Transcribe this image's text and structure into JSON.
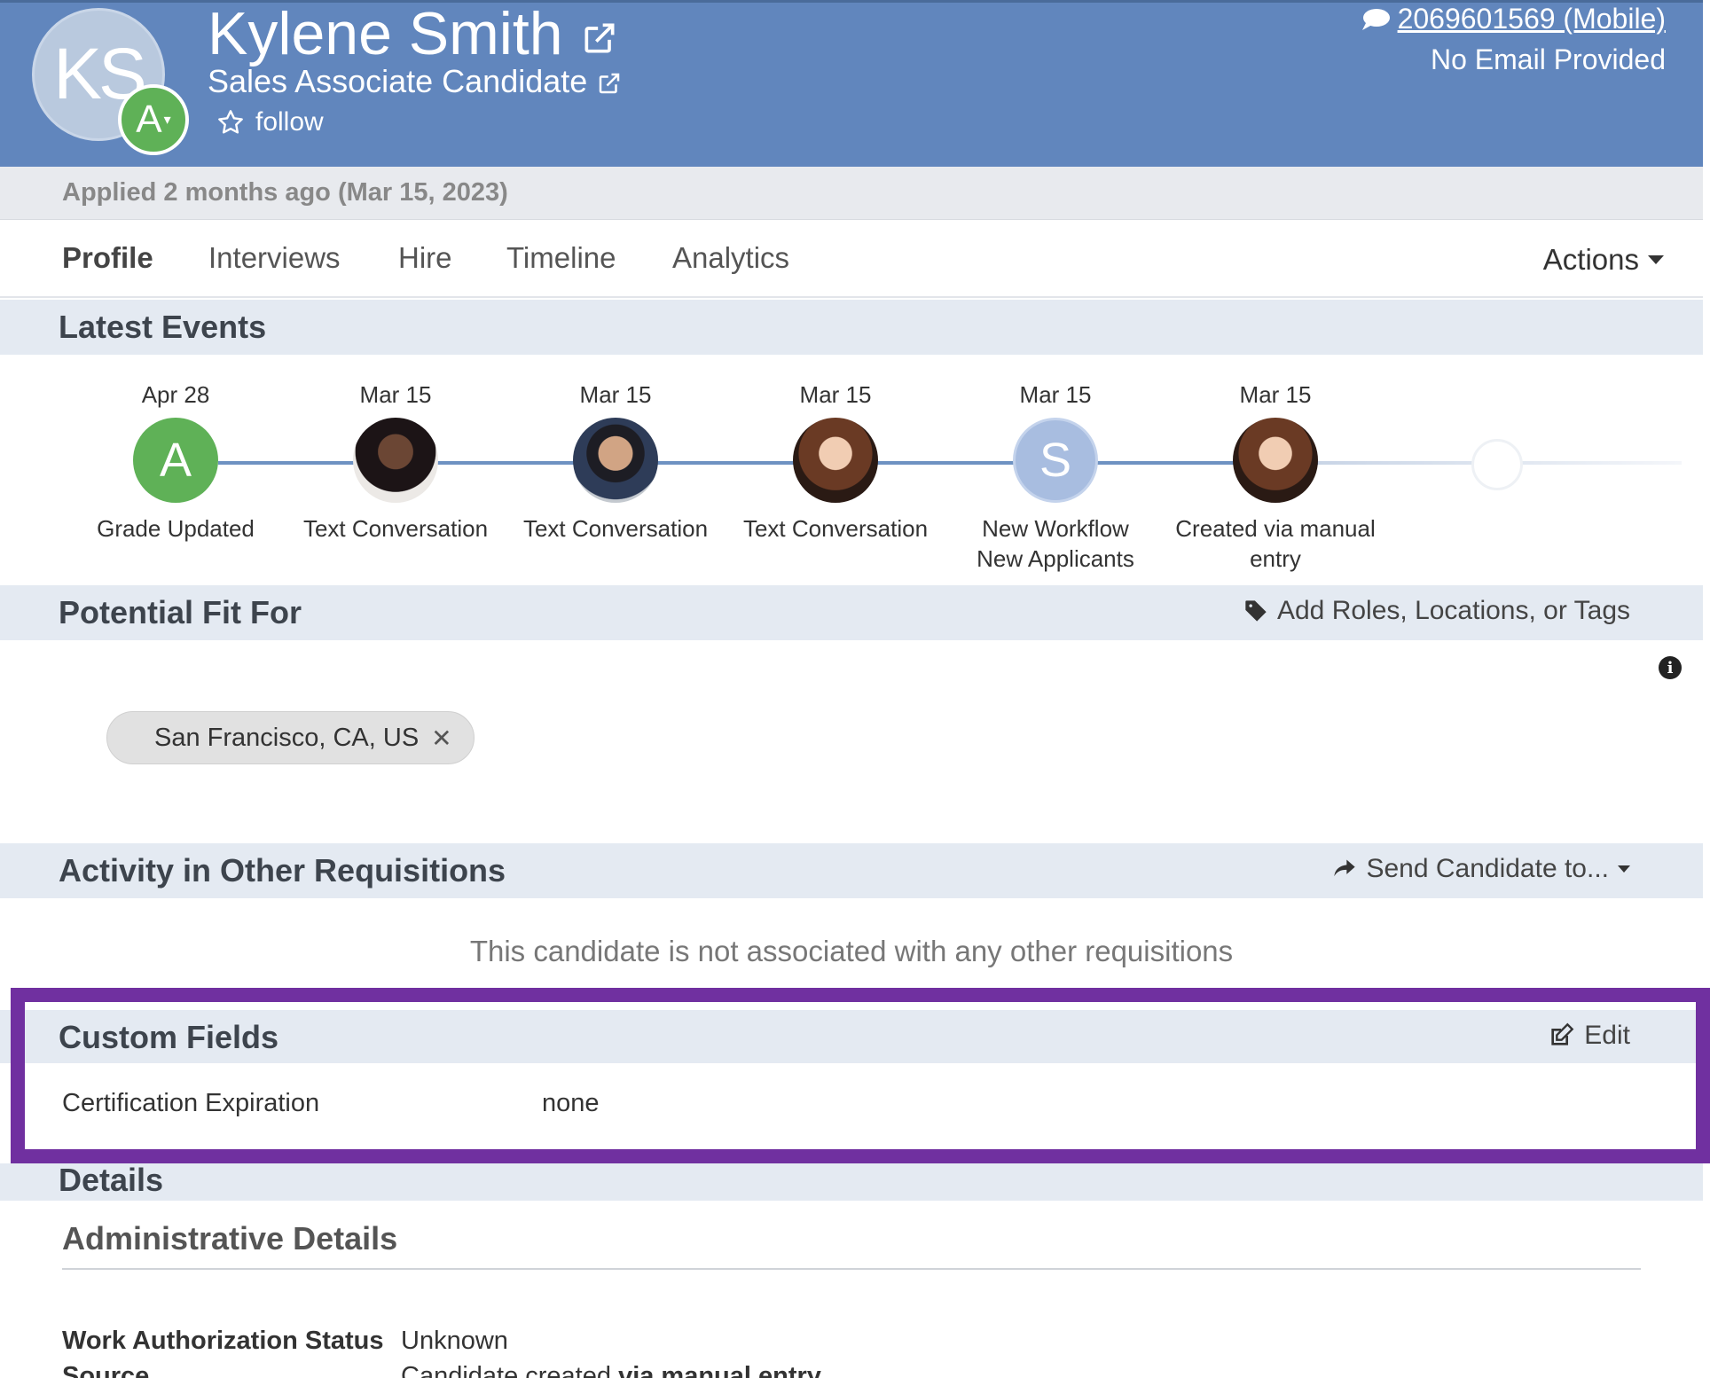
{
  "header": {
    "initials": "KS",
    "grade": "A",
    "name": "Kylene Smith",
    "role": "Sales Associate Candidate",
    "follow_label": "follow",
    "phone": "2069601569 (Mobile)",
    "email": "No Email Provided",
    "colors": {
      "header_bg": "#6186bd",
      "grade_green": "#5fb157"
    }
  },
  "applied": "Applied 2 months ago (Mar 15, 2023)",
  "tabs": [
    "Profile",
    "Interviews",
    "Hire",
    "Timeline",
    "Analytics"
  ],
  "actions_label": "Actions",
  "latest_events": {
    "title": "Latest Events",
    "events": [
      {
        "date": "Apr 28",
        "icon": "grade-letter",
        "glyph": "A",
        "label_lines": [
          "Grade Updated"
        ]
      },
      {
        "date": "Mar 15",
        "icon": "user-photo",
        "glyph": "",
        "label_lines": [
          "Text Conversation"
        ]
      },
      {
        "date": "Mar 15",
        "icon": "user-photo",
        "glyph": "",
        "label_lines": [
          "Text Conversation"
        ]
      },
      {
        "date": "Mar 15",
        "icon": "user-photo",
        "glyph": "",
        "label_lines": [
          "Text Conversation"
        ]
      },
      {
        "date": "Mar 15",
        "icon": "workflow-letter",
        "glyph": "S",
        "label_lines": [
          "New Workflow",
          "New Applicants"
        ]
      },
      {
        "date": "Mar 15",
        "icon": "user-photo",
        "glyph": "",
        "label_lines": [
          "Created via manual",
          "entry"
        ]
      }
    ]
  },
  "potential_fit": {
    "title": "Potential Fit For",
    "add_label": "Add Roles, Locations, or Tags",
    "tags": [
      "San Francisco, CA, US"
    ]
  },
  "other_requisitions": {
    "title": "Activity in Other Requisitions",
    "send_label": "Send Candidate to...",
    "empty_message": "This candidate is not associated with any other requisitions"
  },
  "custom_fields": {
    "title": "Custom Fields",
    "edit_label": "Edit",
    "fields": [
      {
        "label": "Certification Expiration",
        "value": "none"
      }
    ]
  },
  "details": {
    "title": "Details",
    "admin_title": "Administrative Details",
    "work_auth_label": "Work Authorization Status",
    "work_auth_value": "Unknown",
    "source_label": "Source",
    "source_value_prefix": "Candidate created ",
    "source_value_bold": "via manual entry"
  }
}
